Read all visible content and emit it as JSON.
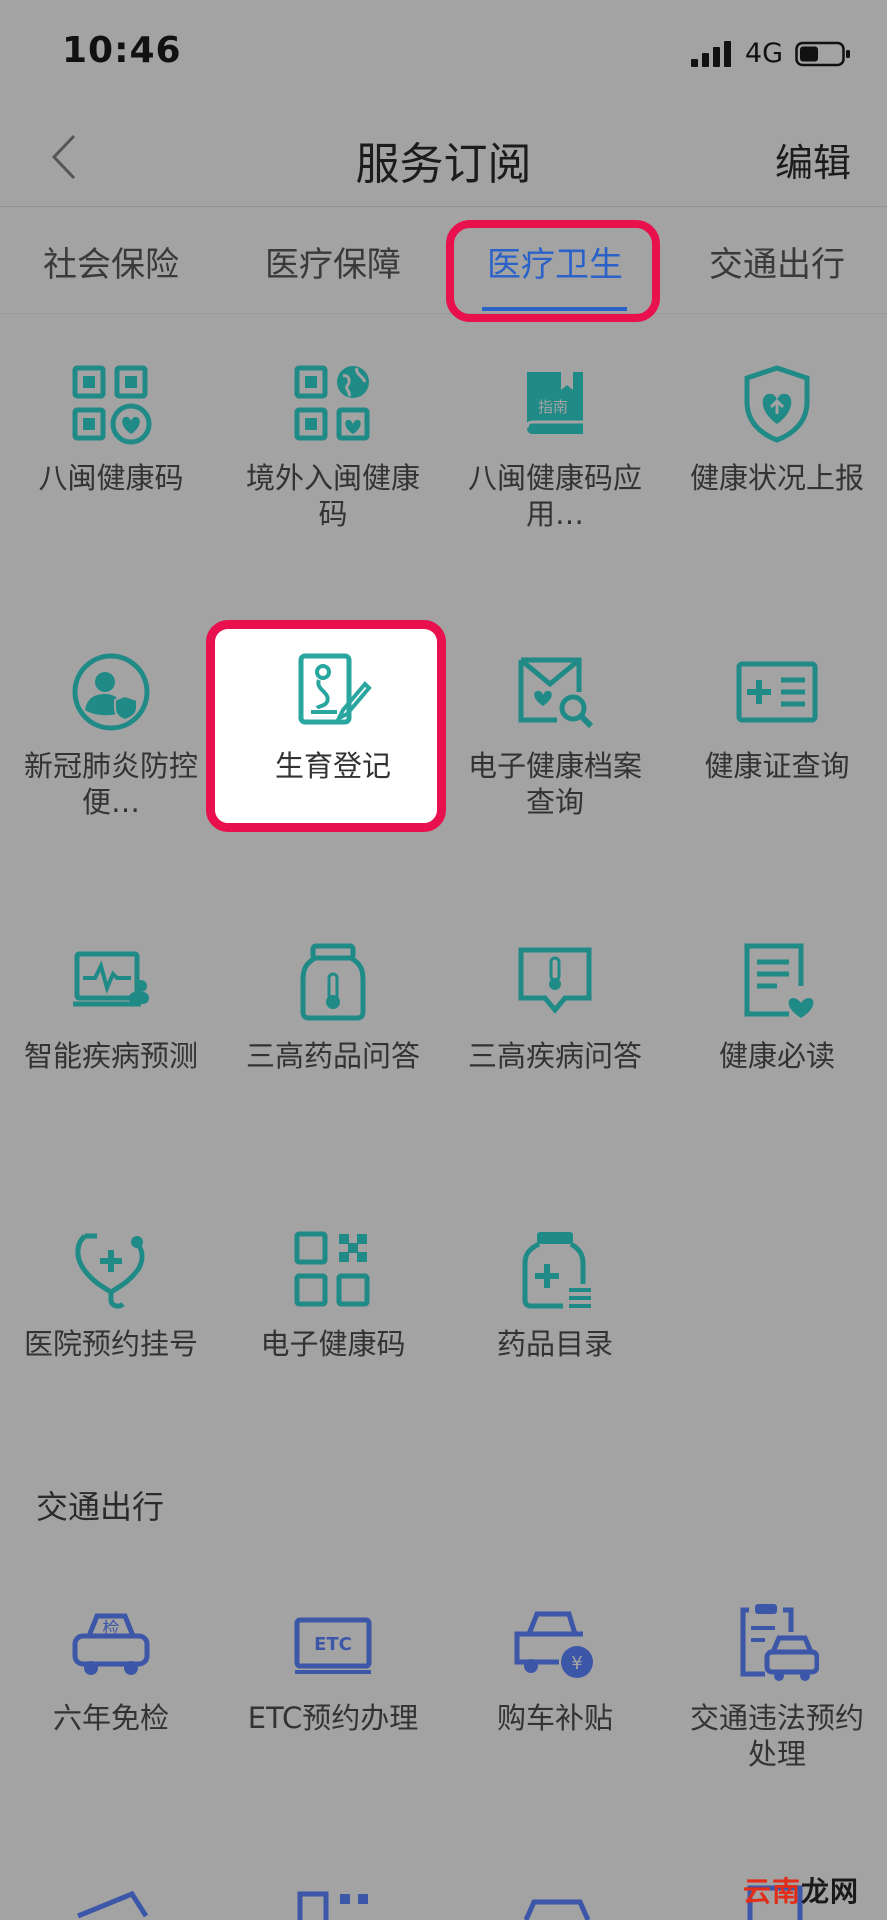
{
  "status_bar": {
    "time": "10:46",
    "network": "4G"
  },
  "nav": {
    "title": "服务订阅",
    "edit_label": "编辑"
  },
  "tabs": [
    {
      "label": "社会保险"
    },
    {
      "label": "医疗保障"
    },
    {
      "label": "医疗卫生"
    },
    {
      "label": "交通出行"
    }
  ],
  "active_tab": "医疗卫生",
  "health_items": [
    {
      "label": "八闽健康码",
      "icon": "qr-health-icon"
    },
    {
      "label": "境外入闽健康码",
      "icon": "qr-globe-icon"
    },
    {
      "label": "八闽健康码应用…",
      "icon": "guide-book-icon",
      "icon_text": "指南"
    },
    {
      "label": "健康状况上报",
      "icon": "shield-heart-icon"
    },
    {
      "label": "新冠肺炎防控便…",
      "icon": "person-shield-icon"
    },
    {
      "label": "生育登记",
      "icon": "pregnancy-register-icon"
    },
    {
      "label": "电子健康档案查询",
      "icon": "health-record-search-icon"
    },
    {
      "label": "健康证查询",
      "icon": "health-card-icon"
    },
    {
      "label": "智能疾病预测",
      "icon": "monitor-pulse-icon"
    },
    {
      "label": "三高药品问答",
      "icon": "medicine-jar-icon"
    },
    {
      "label": "三高疾病问答",
      "icon": "thermometer-chat-icon"
    },
    {
      "label": "健康必读",
      "icon": "document-heart-icon"
    },
    {
      "label": "医院预约挂号",
      "icon": "stethoscope-icon"
    },
    {
      "label": "电子健康码",
      "icon": "qr-code-icon"
    },
    {
      "label": "药品目录",
      "icon": "medicine-bottle-icon"
    }
  ],
  "traffic_section": {
    "title": "交通出行",
    "items": [
      {
        "label": "六年免检",
        "icon": "car-inspection-icon",
        "icon_text": "检"
      },
      {
        "label": "ETC预约办理",
        "icon": "etc-card-icon",
        "icon_text": "ETC"
      },
      {
        "label": "购车补贴",
        "icon": "car-subsidy-icon",
        "icon_text": "¥"
      },
      {
        "label": "交通违法预约处理",
        "icon": "traffic-violation-icon"
      }
    ]
  },
  "colors": {
    "teal": "#1f8a86",
    "blue": "#3c56a8",
    "highlight": "#e8114e",
    "active_tab": "#2a62c9",
    "background": "#a3a3a3"
  },
  "watermark": {
    "part1": "云南",
    "part2": "龙网"
  }
}
